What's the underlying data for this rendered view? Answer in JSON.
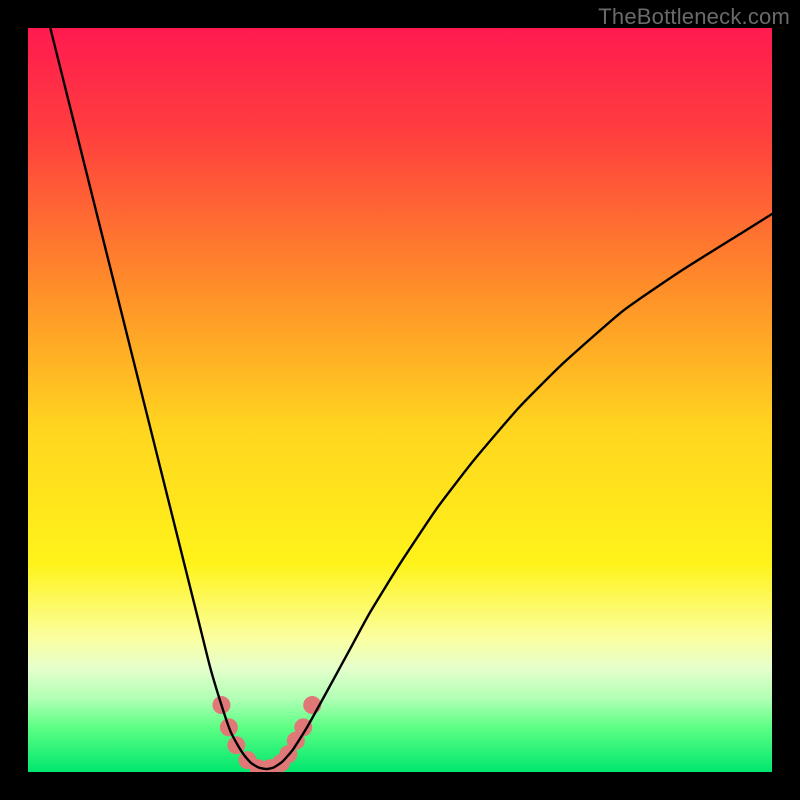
{
  "watermark": "TheBottleneck.com",
  "chart_data": {
    "type": "line",
    "title": "",
    "xlabel": "",
    "ylabel": "",
    "xlim": [
      0,
      100
    ],
    "ylim": [
      0,
      100
    ],
    "background_gradient_stops": [
      {
        "pct": 0,
        "color": "#ff1a50"
      },
      {
        "pct": 14,
        "color": "#ff3e3e"
      },
      {
        "pct": 34,
        "color": "#ff8a2a"
      },
      {
        "pct": 54,
        "color": "#ffd61f"
      },
      {
        "pct": 72,
        "color": "#fff31a"
      },
      {
        "pct": 82,
        "color": "#fbffa0"
      },
      {
        "pct": 86,
        "color": "#e6ffcc"
      },
      {
        "pct": 90,
        "color": "#b3ffb6"
      },
      {
        "pct": 94,
        "color": "#5cff84"
      },
      {
        "pct": 100,
        "color": "#00e66e"
      }
    ],
    "series": [
      {
        "name": "curve",
        "color": "#000000",
        "stroke_width": 2.4,
        "x": [
          3,
          5,
          7,
          9,
          11,
          13,
          15,
          17,
          19,
          21,
          23,
          24.5,
          26,
          27.2,
          28.2,
          29.1,
          30,
          31,
          32,
          33,
          34.2,
          35.6,
          37.5,
          40,
          43,
          46,
          50,
          55,
          60,
          66,
          72,
          80,
          88,
          96,
          100
        ],
        "y": [
          100,
          92,
          84,
          76,
          68,
          60,
          52,
          44,
          36,
          28,
          20,
          14,
          9,
          5.5,
          3.6,
          2.2,
          1.2,
          0.6,
          0.4,
          0.6,
          1.4,
          3,
          6,
          10.5,
          16,
          21.5,
          28,
          35.5,
          42,
          49,
          55,
          62,
          67.5,
          72.5,
          75
        ]
      }
    ],
    "markers": {
      "name": "highlight-dots",
      "color": "#e07878",
      "radius": 9,
      "x": [
        26.0,
        27.0,
        28.0,
        29.5,
        31.0,
        32.5,
        34.0,
        35.0,
        36.0,
        37.0,
        38.2
      ],
      "y": [
        9.0,
        6.0,
        3.6,
        1.6,
        0.5,
        0.5,
        1.2,
        2.4,
        4.2,
        6.0,
        9.0
      ]
    }
  }
}
